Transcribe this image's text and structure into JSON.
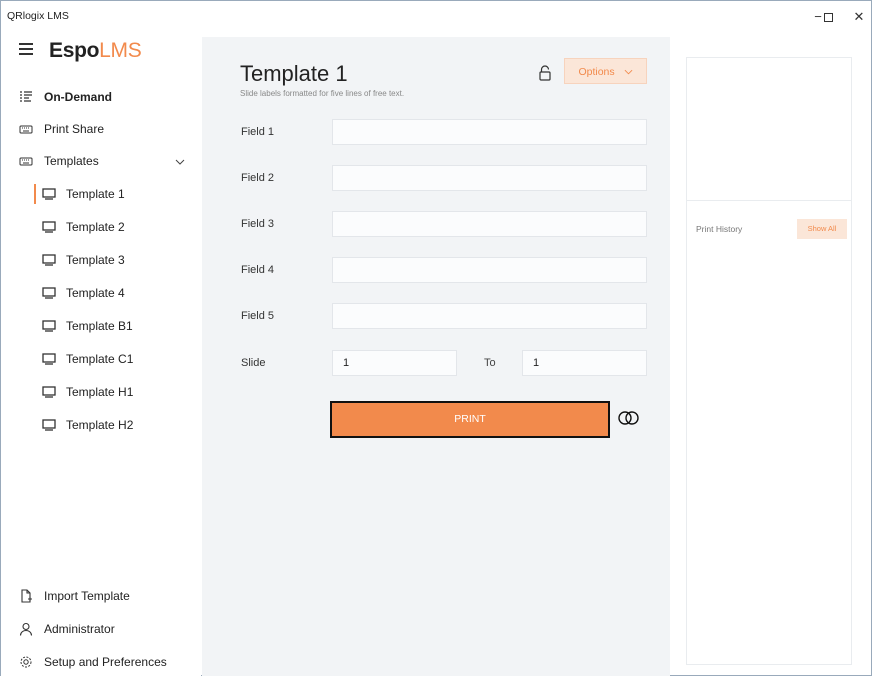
{
  "window": {
    "title": "QRlogix LMS",
    "minimize": "−",
    "maximize": "□",
    "close": "✕"
  },
  "brand": {
    "primary": "Espo",
    "accent": "LMS",
    "accent_color": "#f28a4c"
  },
  "sidebar": {
    "items": [
      {
        "label": "On-Demand",
        "icon": "list-icon"
      },
      {
        "label": "Print Share",
        "icon": "keyboard-icon"
      },
      {
        "label": "Templates",
        "icon": "keyboard-icon"
      }
    ],
    "templates": [
      {
        "label": "Template 1",
        "active": true
      },
      {
        "label": "Template 2"
      },
      {
        "label": "Template 3"
      },
      {
        "label": "Template 4"
      },
      {
        "label": "Template B1"
      },
      {
        "label": "Template C1"
      },
      {
        "label": "Template H1"
      },
      {
        "label": "Template H2"
      }
    ],
    "bottom": [
      {
        "label": "Import Template",
        "icon": "file-add-icon"
      },
      {
        "label": "Administrator",
        "icon": "person-icon"
      },
      {
        "label": "Setup and Preferences",
        "icon": "gear-icon"
      }
    ]
  },
  "main": {
    "title": "Template 1",
    "subtitle": "Slide labels formatted for five lines of free text.",
    "options_label": "Options",
    "fields": [
      {
        "label": "Field 1",
        "value": ""
      },
      {
        "label": "Field 2",
        "value": ""
      },
      {
        "label": "Field 3",
        "value": ""
      },
      {
        "label": "Field 4",
        "value": ""
      },
      {
        "label": "Field 5",
        "value": ""
      }
    ],
    "slide_label": "Slide",
    "slide_from": "1",
    "to_label": "To",
    "slide_to": "1",
    "print_label": "PRINT"
  },
  "history": {
    "label": "Print History",
    "show_all": "Show All"
  }
}
